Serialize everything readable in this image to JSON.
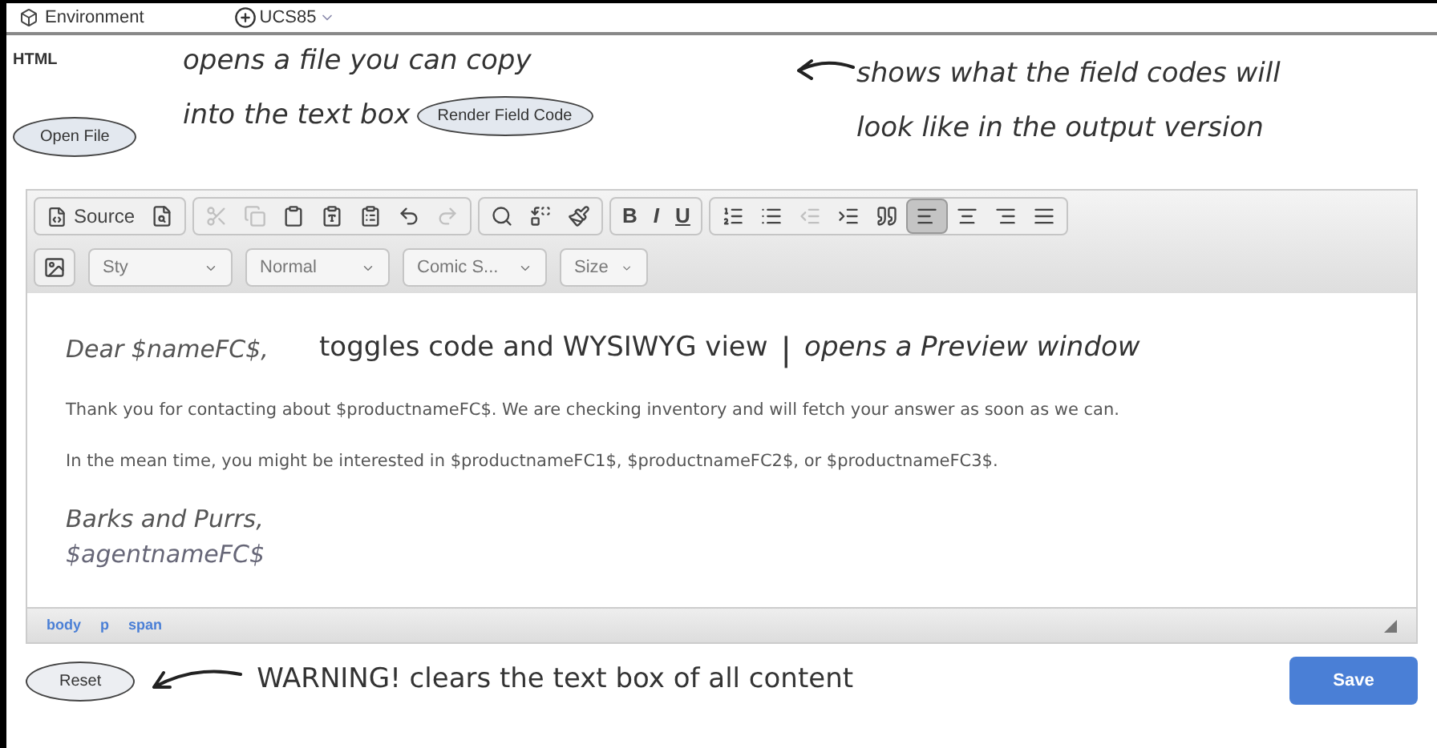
{
  "header": {
    "environment": "Environment",
    "account": "UCS85"
  },
  "section_label": "HTML",
  "open_file_button": "Open File",
  "render_button": "Render Field Code",
  "annotations": {
    "open_file_line1": "opens a file you can copy",
    "open_file_line2": "into the text box",
    "render_line1": "shows what the field codes will",
    "render_line2": "look like in the output version",
    "source": "toggles code and WYSIWYG view",
    "divider": "|",
    "preview": "opens a Preview window",
    "reset": "WARNING! clears the text box of all content"
  },
  "toolbar_groups": [
    [
      {
        "kind": "text",
        "label": "Source",
        "disabled": false,
        "selected": false
      },
      {
        "kind": "icon",
        "disabled": false,
        "selected": false
      }
    ],
    [
      {
        "kind": "icon",
        "disabled": true,
        "selected": false
      },
      {
        "kind": "icon",
        "disabled": true,
        "selected": false
      },
      {
        "kind": "icon",
        "disabled": false,
        "selected": false
      },
      {
        "kind": "icon",
        "disabled": false,
        "selected": false
      },
      {
        "kind": "icon",
        "disabled": false,
        "selected": false
      },
      {
        "kind": "icon",
        "disabled": false,
        "selected": false
      },
      {
        "kind": "icon",
        "disabled": true,
        "selected": false
      }
    ],
    [
      {
        "kind": "icon",
        "disabled": false,
        "selected": false
      },
      {
        "kind": "icon",
        "disabled": false,
        "selected": false
      },
      {
        "kind": "icon",
        "disabled": false,
        "selected": false
      }
    ],
    [
      {
        "kind": "letter",
        "label": "B",
        "disabled": false,
        "selected": false
      },
      {
        "kind": "letter",
        "label": "I",
        "disabled": false,
        "selected": false
      },
      {
        "kind": "letter",
        "label": "U",
        "disabled": false,
        "selected": false
      }
    ],
    [
      {
        "kind": "icon",
        "disabled": false,
        "selected": false
      },
      {
        "kind": "icon",
        "disabled": false,
        "selected": false
      },
      {
        "kind": "icon",
        "disabled": true,
        "selected": false
      },
      {
        "kind": "icon",
        "disabled": false,
        "selected": false
      },
      {
        "kind": "icon",
        "disabled": false,
        "selected": false
      },
      {
        "kind": "icon",
        "disabled": false,
        "selected": true
      },
      {
        "kind": "icon",
        "disabled": false,
        "selected": false
      },
      {
        "kind": "icon",
        "disabled": false,
        "selected": false
      },
      {
        "kind": "icon",
        "disabled": false,
        "selected": false
      }
    ]
  ],
  "dropdowns": [
    {
      "label": "Sty"
    },
    {
      "label": "Normal"
    },
    {
      "label": "Comic S..."
    },
    {
      "label": "Size"
    }
  ],
  "content": {
    "greeting": "Dear $nameFC$,",
    "paragraphs": [
      "Thank you for contacting about $productnameFC$. We are checking inventory and will fetch your answer as soon as we can.",
      "In the mean time, you might be interested in $productnameFC1$, $productnameFC2$, or $productnameFC3$."
    ],
    "closing": "Barks and Purrs,",
    "signature": "$agentnameFC$"
  },
  "path": [
    "body",
    "p",
    "span"
  ],
  "reset_button": "Reset",
  "save_button": "Save"
}
